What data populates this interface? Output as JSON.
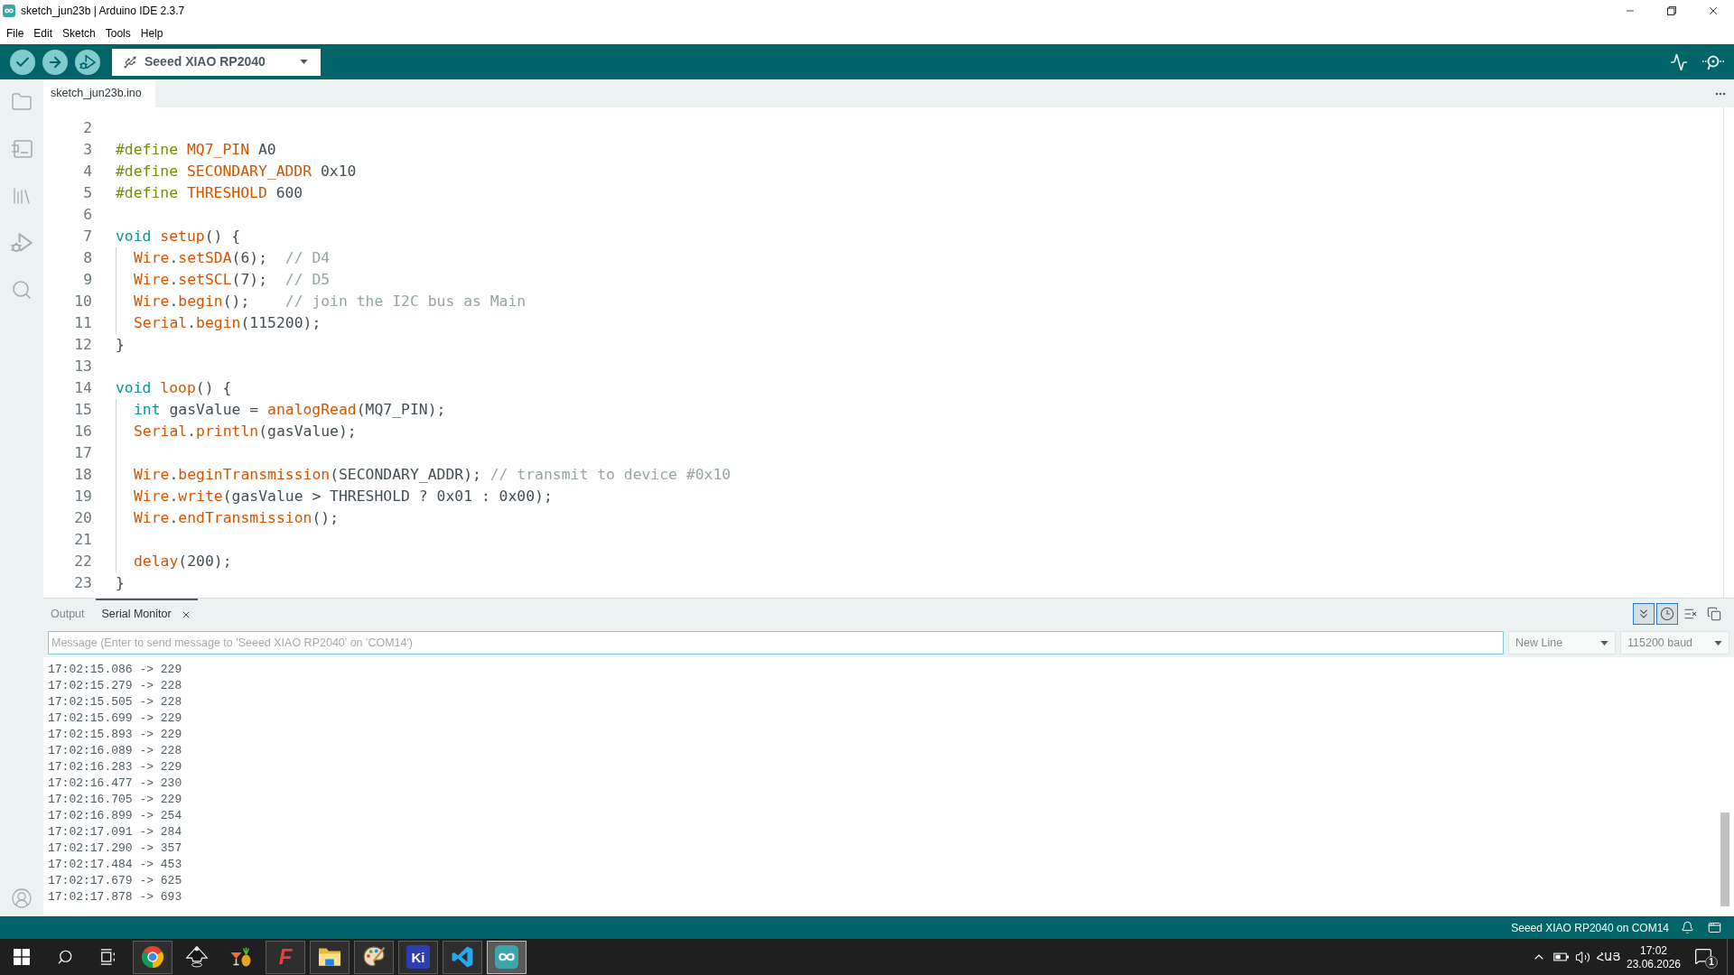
{
  "window": {
    "title": "sketch_jun23b | Arduino IDE 2.3.7"
  },
  "menu": [
    "File",
    "Edit",
    "Sketch",
    "Tools",
    "Help"
  ],
  "toolbar": {
    "board": "Seeed XIAO RP2040"
  },
  "editor_tabs": [
    {
      "label": "sketch_jun23b.ino",
      "selected": true
    }
  ],
  "editor": {
    "lines": [
      {
        "number": "2"
      },
      {
        "number": "3",
        "tokens": [
          {
            "kind": "directive",
            "text": "#define"
          },
          {
            "kind": "name",
            "text": " MQ7_PIN"
          },
          {
            "kind": "plain",
            "text": " A0"
          }
        ]
      },
      {
        "number": "4",
        "tokens": [
          {
            "kind": "directive",
            "text": "#define"
          },
          {
            "kind": "name",
            "text": " SECONDARY_ADDR"
          },
          {
            "kind": "plain",
            "text": " 0x10"
          }
        ]
      },
      {
        "number": "5",
        "tokens": [
          {
            "kind": "directive",
            "text": "#define"
          },
          {
            "kind": "name",
            "text": " THRESHOLD"
          },
          {
            "kind": "plain",
            "text": " 600"
          }
        ]
      },
      {
        "number": "6"
      },
      {
        "number": "7",
        "tokens": [
          {
            "kind": "keyword",
            "text": "void"
          },
          {
            "kind": "name",
            "text": " setup"
          },
          {
            "kind": "plain",
            "text": "() {"
          }
        ],
        "children": [
          {
            "number": "8",
            "tokens": [
              {
                "kind": "name",
                "text": "Wire"
              },
              {
                "kind": "plain",
                "text": "."
              },
              {
                "kind": "name",
                "text": "setSDA"
              },
              {
                "kind": "plain",
                "text": "(6);  "
              },
              {
                "kind": "comment",
                "text": "// D4"
              }
            ]
          },
          {
            "number": "9",
            "tokens": [
              {
                "kind": "name",
                "text": "Wire"
              },
              {
                "kind": "plain",
                "text": "."
              },
              {
                "kind": "name",
                "text": "setSCL"
              },
              {
                "kind": "plain",
                "text": "(7);  "
              },
              {
                "kind": "comment",
                "text": "// D5"
              }
            ]
          },
          {
            "number": "10",
            "tokens": [
              {
                "kind": "name",
                "text": "Wire"
              },
              {
                "kind": "plain",
                "text": "."
              },
              {
                "kind": "name",
                "text": "begin"
              },
              {
                "kind": "plain",
                "text": "();    "
              },
              {
                "kind": "comment",
                "text": "// join the I2C bus as Main"
              }
            ]
          },
          {
            "number": "11",
            "tokens": [
              {
                "kind": "name",
                "text": "Serial"
              },
              {
                "kind": "plain",
                "text": "."
              },
              {
                "kind": "name",
                "text": "begin"
              },
              {
                "kind": "plain",
                "text": "(115200);"
              }
            ]
          }
        ]
      },
      {
        "number": "12",
        "tokens": [
          {
            "kind": "plain",
            "text": "}"
          }
        ]
      },
      {
        "number": "13"
      },
      {
        "number": "14",
        "tokens": [
          {
            "kind": "keyword",
            "text": "void"
          },
          {
            "kind": "name",
            "text": " loop"
          },
          {
            "kind": "plain",
            "text": "() {"
          }
        ],
        "children": [
          {
            "number": "15",
            "tokens": [
              {
                "kind": "keyword",
                "text": "int"
              },
              {
                "kind": "plain",
                "text": " gasValue = "
              },
              {
                "kind": "name",
                "text": "analogRead"
              },
              {
                "kind": "plain",
                "text": "(MQ7_PIN);"
              }
            ]
          },
          {
            "number": "16",
            "tokens": [
              {
                "kind": "name",
                "text": "Serial"
              },
              {
                "kind": "plain",
                "text": "."
              },
              {
                "kind": "name",
                "text": "println"
              },
              {
                "kind": "plain",
                "text": "(gasValue);"
              }
            ]
          },
          {
            "number": "17"
          },
          {
            "number": "18",
            "tokens": [
              {
                "kind": "name",
                "text": "Wire"
              },
              {
                "kind": "plain",
                "text": "."
              },
              {
                "kind": "name",
                "text": "beginTransmission"
              },
              {
                "kind": "plain",
                "text": "(SECONDARY_ADDR); "
              },
              {
                "kind": "comment",
                "text": "// transmit to device #0x10"
              }
            ]
          },
          {
            "number": "19",
            "tokens": [
              {
                "kind": "name",
                "text": "Wire"
              },
              {
                "kind": "plain",
                "text": "."
              },
              {
                "kind": "name",
                "text": "write"
              },
              {
                "kind": "plain",
                "text": "(gasValue > THRESHOLD ? 0x01 : 0x00);"
              }
            ]
          },
          {
            "number": "20",
            "tokens": [
              {
                "kind": "name",
                "text": "Wire"
              },
              {
                "kind": "plain",
                "text": "."
              },
              {
                "kind": "name",
                "text": "endTransmission"
              },
              {
                "kind": "plain",
                "text": "();"
              }
            ]
          },
          {
            "number": "21"
          },
          {
            "number": "22",
            "tokens": [
              {
                "kind": "name",
                "text": "delay"
              },
              {
                "kind": "plain",
                "text": "(200);"
              }
            ]
          }
        ]
      },
      {
        "number": "23",
        "tokens": [
          {
            "kind": "plain",
            "text": "}"
          }
        ]
      }
    ]
  },
  "panel": {
    "tabs": [
      {
        "label": "Output",
        "selected": false,
        "closable": false
      },
      {
        "label": "Serial Monitor",
        "selected": true,
        "closable": true
      }
    ],
    "tools": [
      {
        "kind": "autoscroll",
        "on": true
      },
      {
        "kind": "timestamp",
        "on": true
      },
      {
        "kind": "clear",
        "on": false
      },
      {
        "kind": "copy",
        "on": false
      }
    ],
    "message": {
      "placeholder": "Message (Enter to send message to 'Seeed XIAO RP2040' on 'COM14')"
    },
    "line_ending": "New Line",
    "baud_rate": "115200 baud",
    "output": [
      "17:02:15.086 -> 229",
      "17:02:15.279 -> 228",
      "17:02:15.505 -> 228",
      "17:02:15.699 -> 229",
      "17:02:15.893 -> 229",
      "17:02:16.089 -> 228",
      "17:02:16.283 -> 229",
      "17:02:16.477 -> 230",
      "17:02:16.705 -> 229",
      "17:02:16.899 -> 254",
      "17:02:17.091 -> 284",
      "17:02:17.290 -> 357",
      "17:02:17.484 -> 453",
      "17:02:17.679 -> 625",
      "17:02:17.878 -> 693"
    ]
  },
  "status_bar": {
    "text": "Seeed XIAO RP2040 on COM14"
  },
  "taskbar": {
    "apps": [
      {
        "kind": "browser",
        "running": true,
        "selected": false
      },
      {
        "kind": "vector",
        "running": false,
        "selected": false
      },
      {
        "kind": "drinks",
        "running": false,
        "selected": false
      },
      {
        "kind": "letter",
        "label": "F",
        "color": "#e5403a",
        "running": true,
        "selected": false
      },
      {
        "kind": "folder",
        "running": true,
        "selected": false
      },
      {
        "kind": "palette",
        "running": true,
        "selected": false
      },
      {
        "kind": "tile",
        "label": "Ki",
        "color": "#2d3fb0",
        "running": true,
        "selected": false
      },
      {
        "kind": "ribbon",
        "running": true,
        "selected": false
      },
      {
        "kind": "infinity",
        "running": true,
        "selected": true
      }
    ],
    "tray": {
      "language": "ՀԱՅ",
      "time": "17:02",
      "date": "23.06.2026",
      "notifications": "1"
    }
  }
}
